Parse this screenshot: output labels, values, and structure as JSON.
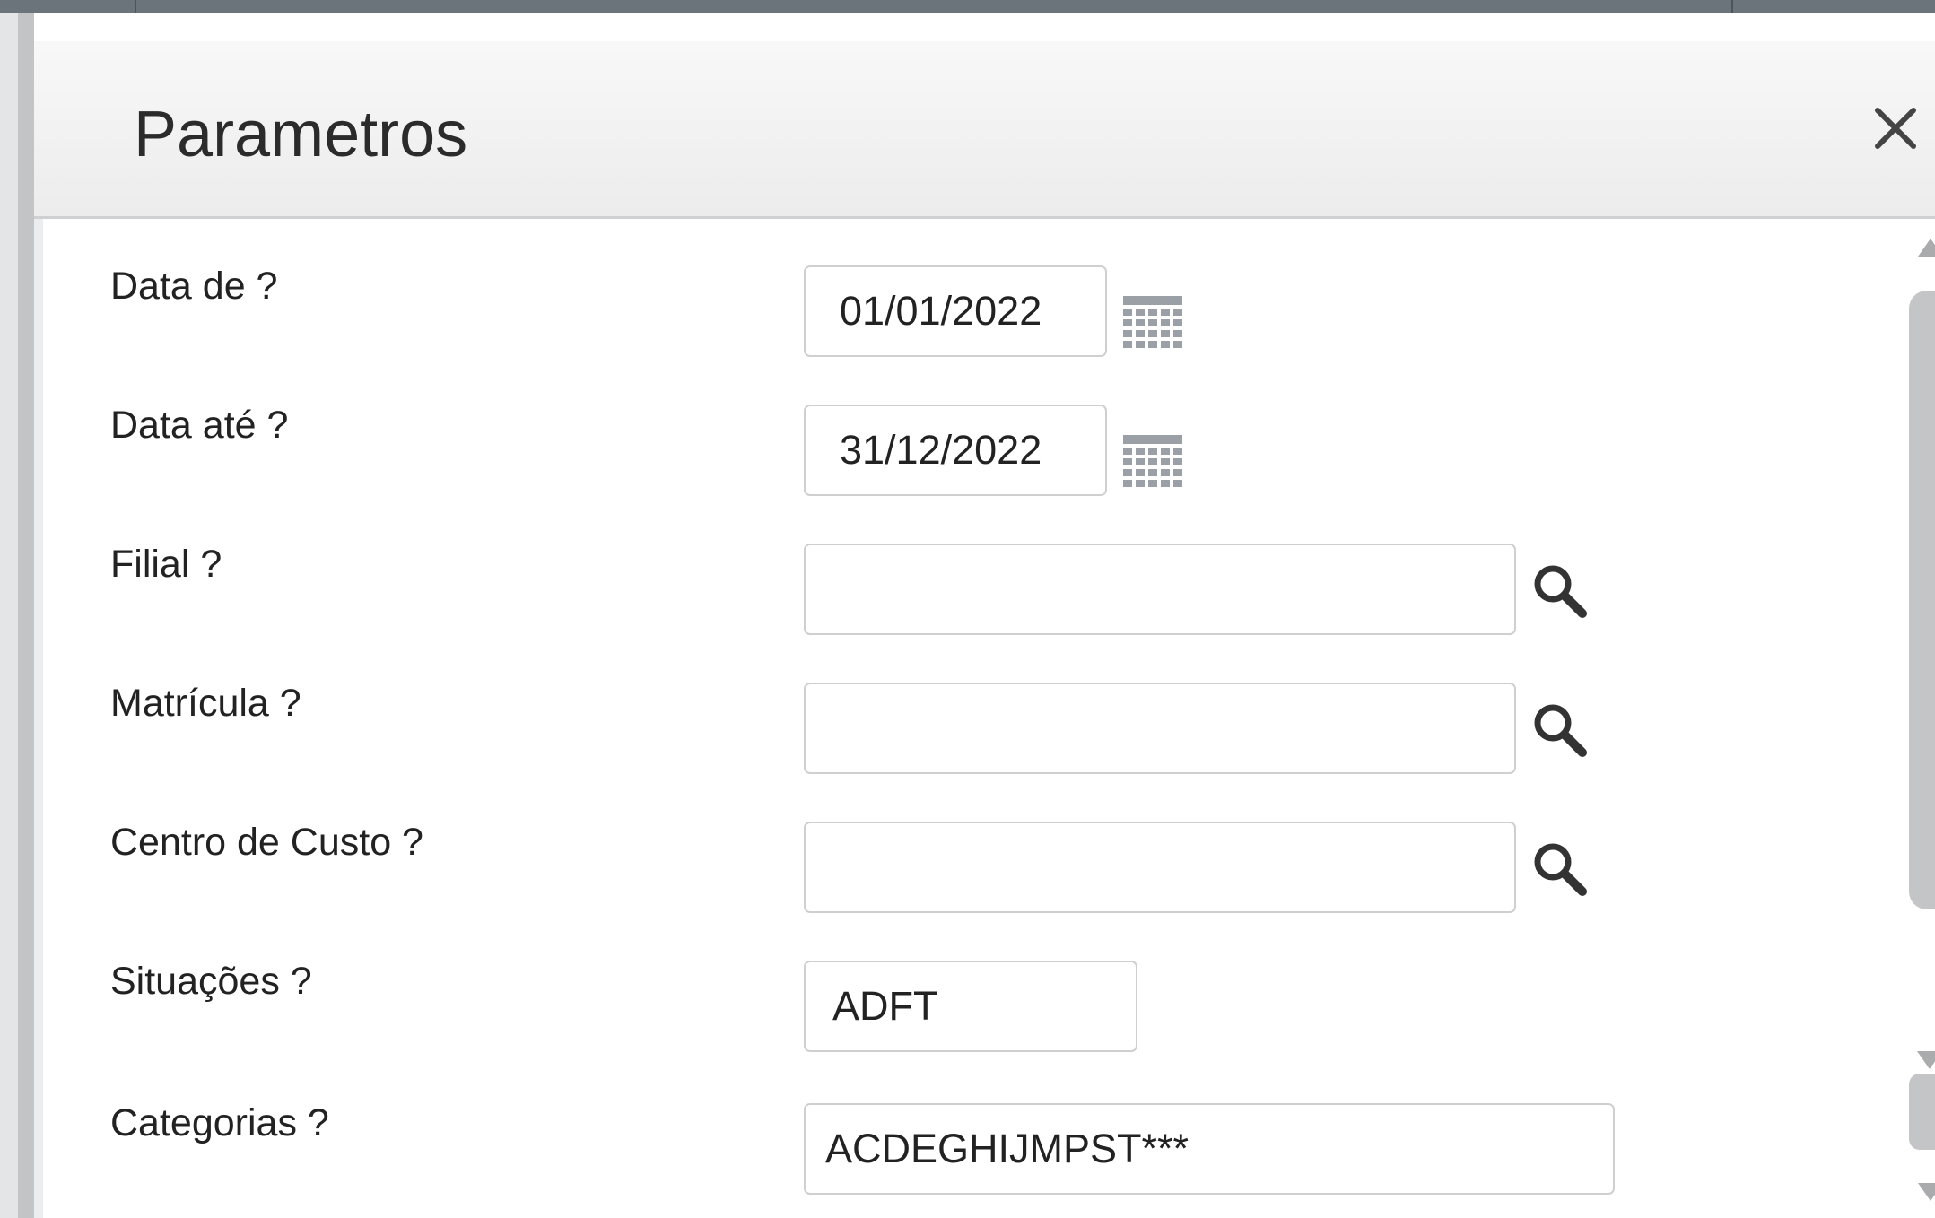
{
  "dialog": {
    "title": "Parametros",
    "close_icon": "close-icon"
  },
  "fields": [
    {
      "label": "Data de ?",
      "value": "01/01/2022",
      "icon": "calendar-icon"
    },
    {
      "label": "Data até ?",
      "value": "31/12/2022",
      "icon": "calendar-icon"
    },
    {
      "label": "Filial ?",
      "value": "",
      "icon": "search-icon"
    },
    {
      "label": "Matrícula ?",
      "value": "",
      "icon": "search-icon"
    },
    {
      "label": "Centro de Custo ?",
      "value": "",
      "icon": "search-icon"
    },
    {
      "label": "Situações ?",
      "value": "ADFT"
    },
    {
      "label": "Categorias ?",
      "value": "ACDEGHIJMPST***"
    }
  ],
  "colors": {
    "header_bg": "#efefef",
    "field_border": "#cfcfcf",
    "topbar": "#6b737b"
  }
}
